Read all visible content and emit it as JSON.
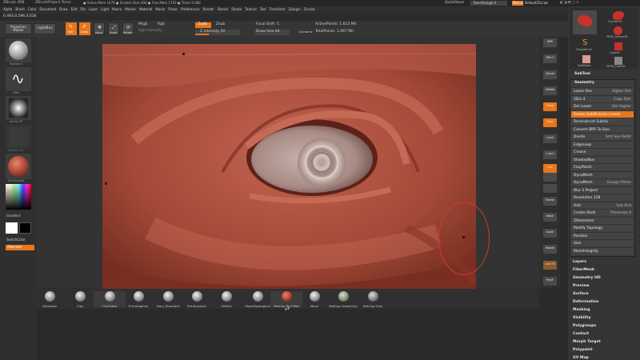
{
  "titlebar": {
    "app": "ZBrush 4R8",
    "project": "ZBrushProject Torso",
    "stats": "● Active Mem 1470 ● Scratch Disk 404 ● Free Mem 1702 ● Timer 0.084",
    "quicksave": "QuickSave",
    "see_through": "See-through  0",
    "menus_btn": "Menus",
    "default_script": "DefaultZScript"
  },
  "menubar": {
    "items": [
      "Alpha",
      "Brush",
      "Color",
      "Document",
      "Draw",
      "Edit",
      "File",
      "Layer",
      "Light",
      "Macro",
      "Marker",
      "Material",
      "Movie",
      "Picker",
      "Preferences",
      "Render",
      "Stencil",
      "Stroke",
      "Texture",
      "Tool",
      "Transform",
      "Zplugin",
      "Zscript"
    ],
    "coords": "0.493,0.596,0.616"
  },
  "toolbar": {
    "projection_master": "Projection Master",
    "lightbox": "LightBox",
    "edit": "Edit",
    "draw": "Draw",
    "move": "Move",
    "scale": "Scale",
    "rotate": "Rotate",
    "mrgb": "Mrgb",
    "rgb": "Rgb",
    "rgb_intensity": "Rgb Intensity",
    "zadd": "Zadd",
    "zsub": "Zsub",
    "z_intensity": "Z Intensity 30",
    "focal_shift": "Focal Shift -1",
    "draw_size": "Draw Size 64",
    "dynamic": "Dynamic",
    "active_points": "ActivePoints: 1.613 Mil",
    "total_points": "TotalPoints: 1.967 Mil"
  },
  "left_shelf": {
    "items": [
      "Standard",
      "Dots",
      "Alpha Off",
      "Texture Off",
      "SkinShade4"
    ],
    "gradient": "Gradient",
    "switch_color": "SwitchColor",
    "alternate": "Alternate"
  },
  "right_shelf": {
    "items": [
      "BPR",
      "SPix 3",
      "Actual",
      "AAHalf",
      "Dynamic",
      "Persp",
      "Floor",
      "Local",
      "L.Sym",
      "XYZ",
      "",
      "",
      "Frame",
      "Move",
      "Scale",
      "Rotate",
      "Line Fill",
      "PolyF",
      "Transp",
      "",
      "Solo"
    ]
  },
  "tool_palette": {
    "thumbnails": [
      "Cylinder3D",
      "PM3D_Sphere3D",
      "SimpleBrush",
      "Cube3D",
      "SubdMesh",
      "PM3D_Cube3D"
    ],
    "header": "SubTool",
    "geometry_title": "Geometry",
    "rows": [
      {
        "label": "Lower Res",
        "right": "Higher Res",
        "orange": false
      },
      {
        "label": "SDiv 4",
        "right": "Cage  Rstr",
        "orange": false
      },
      {
        "label": "Del Lower",
        "right": "Del Higher",
        "orange": false
      },
      {
        "label": "Freeze SubDivision Levels",
        "right": "",
        "orange": true
      },
      {
        "label": "Reconstruct Subdiv",
        "right": "",
        "orange": false
      },
      {
        "label": "Convert BPR To Geo",
        "right": "",
        "orange": false
      },
      {
        "label": "Divide",
        "right": "Smt  Suv  ReUV",
        "orange": false
      },
      {
        "label": "EdgeLoop",
        "right": "",
        "orange": false
      },
      {
        "label": "Crease",
        "right": "",
        "orange": false
      },
      {
        "label": "ShadowBox",
        "right": "",
        "orange": false
      },
      {
        "label": "ClayPolish",
        "right": "",
        "orange": false
      },
      {
        "label": "DynaMesh",
        "right": "",
        "orange": false
      },
      {
        "label": "DynaMesh",
        "right": "Groups  Polish",
        "orange": false
      },
      {
        "label": "Blur 2  Project",
        "right": "",
        "orange": false
      },
      {
        "label": "Resolution 128",
        "right": "",
        "orange": false
      },
      {
        "label": "Add",
        "right": "Sub  And",
        "orange": false
      },
      {
        "label": "Create Shell",
        "right": "Thickness 4",
        "orange": false
      },
      {
        "label": "ZRemesher",
        "right": "",
        "orange": false
      },
      {
        "label": "Modify Topology",
        "right": "",
        "orange": false
      },
      {
        "label": "Position",
        "right": "",
        "orange": false
      },
      {
        "label": "Size",
        "right": "",
        "orange": false
      },
      {
        "label": "MeshIntegrity",
        "right": "",
        "orange": false
      }
    ],
    "menu": [
      "Layers",
      "FiberMesh",
      "Geometry HD",
      "Preview",
      "Surface",
      "Deformation",
      "Masking",
      "Visibility",
      "Polygroups",
      "Contact",
      "Morph Target",
      "Polypaint",
      "UV Map"
    ]
  },
  "brush_bar": {
    "items": [
      "Standard",
      "Clay",
      "ClayTubes",
      "TrimAdaptive",
      "Dam_Standard",
      "TrimDynamic",
      "hPolish",
      "MoveTopological",
      "MatCap Red Wax",
      "Move",
      "MatCap GreenClay",
      "MatCap Gray"
    ]
  },
  "colors": {
    "accent": "#e8761b",
    "skin": "#b45a48",
    "ui_bg": "#2b2b2b"
  }
}
